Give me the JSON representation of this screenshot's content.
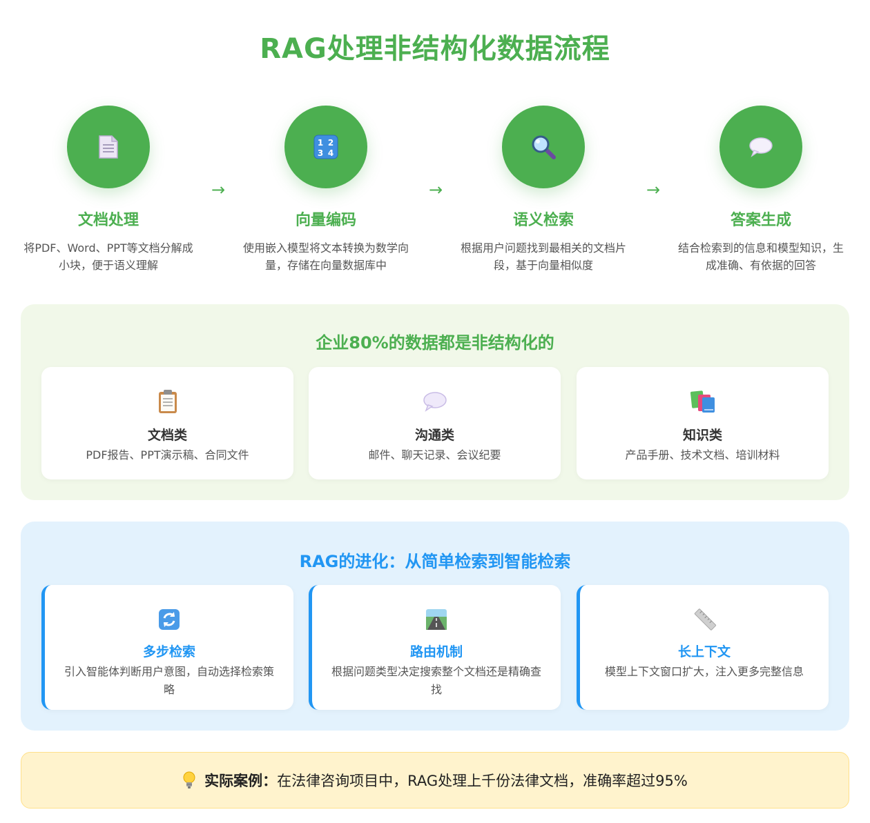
{
  "title": "RAG处理非结构化数据流程",
  "steps": [
    {
      "icon": "document-icon",
      "name": "文档处理",
      "desc": "将PDF、Word、PPT等文档分解成小块，便于语义理解"
    },
    {
      "icon": "numbers-icon",
      "name": "向量编码",
      "desc": "使用嵌入模型将文本转换为数学向量，存储在向量数据库中"
    },
    {
      "icon": "magnifier-icon",
      "name": "语义检索",
      "desc": "根据用户问题找到最相关的文档片段，基于向量相似度"
    },
    {
      "icon": "speech-bubble-icon",
      "name": "答案生成",
      "desc": "结合检索到的信息和模型知识，生成准确、有依据的回答"
    }
  ],
  "arrow": "→",
  "unstructured": {
    "title": "企业80%的数据都是非结构化的",
    "cards": [
      {
        "icon": "clipboard-icon",
        "title": "文档类",
        "desc": "PDF报告、PPT演示稿、合同文件"
      },
      {
        "icon": "speech-bubble-icon",
        "title": "沟通类",
        "desc": "邮件、聊天记录、会议纪要"
      },
      {
        "icon": "books-icon",
        "title": "知识类",
        "desc": "产品手册、技术文档、培训材料"
      }
    ]
  },
  "evolution": {
    "title": "RAG的进化：从简单检索到智能检索",
    "cards": [
      {
        "icon": "refresh-icon",
        "title": "多步检索",
        "desc": "引入智能体判断用户意图，自动选择检索策略"
      },
      {
        "icon": "road-icon",
        "title": "路由机制",
        "desc": "根据问题类型决定搜索整个文档还是精确查找"
      },
      {
        "icon": "ruler-icon",
        "title": "长上下文",
        "desc": "模型上下文窗口扩大，注入更多完整信息"
      }
    ]
  },
  "case": {
    "label": "实际案例：",
    "text": "在法律咨询项目中，RAG处理上千份法律文档，准确率超过95%"
  },
  "colors": {
    "green": "#4caf50",
    "blue": "#2196f3",
    "green_bg": "#f1f8e9",
    "blue_bg": "#e3f2fd",
    "case_bg": "#fff3cd"
  }
}
